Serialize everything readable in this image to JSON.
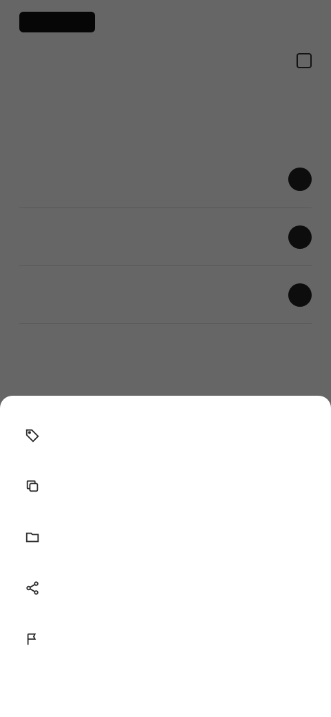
{
  "app": {
    "top_action": "",
    "subheader_title": "",
    "tabs": [
      "",
      ""
    ],
    "section_label": "",
    "rows": [
      "",
      "",
      ""
    ]
  },
  "sheet": {
    "items": [
      {
        "label": "",
        "icon": "tag-icon"
      },
      {
        "label": "",
        "icon": "copy-icon"
      },
      {
        "label": "",
        "icon": "folder-icon"
      },
      {
        "label": "",
        "icon": "share-icon"
      },
      {
        "label": "",
        "icon": "flag-icon"
      }
    ]
  },
  "colors": {
    "scrim": "#000000",
    "sheet_bg": "#ffffff",
    "text": "#222222"
  }
}
